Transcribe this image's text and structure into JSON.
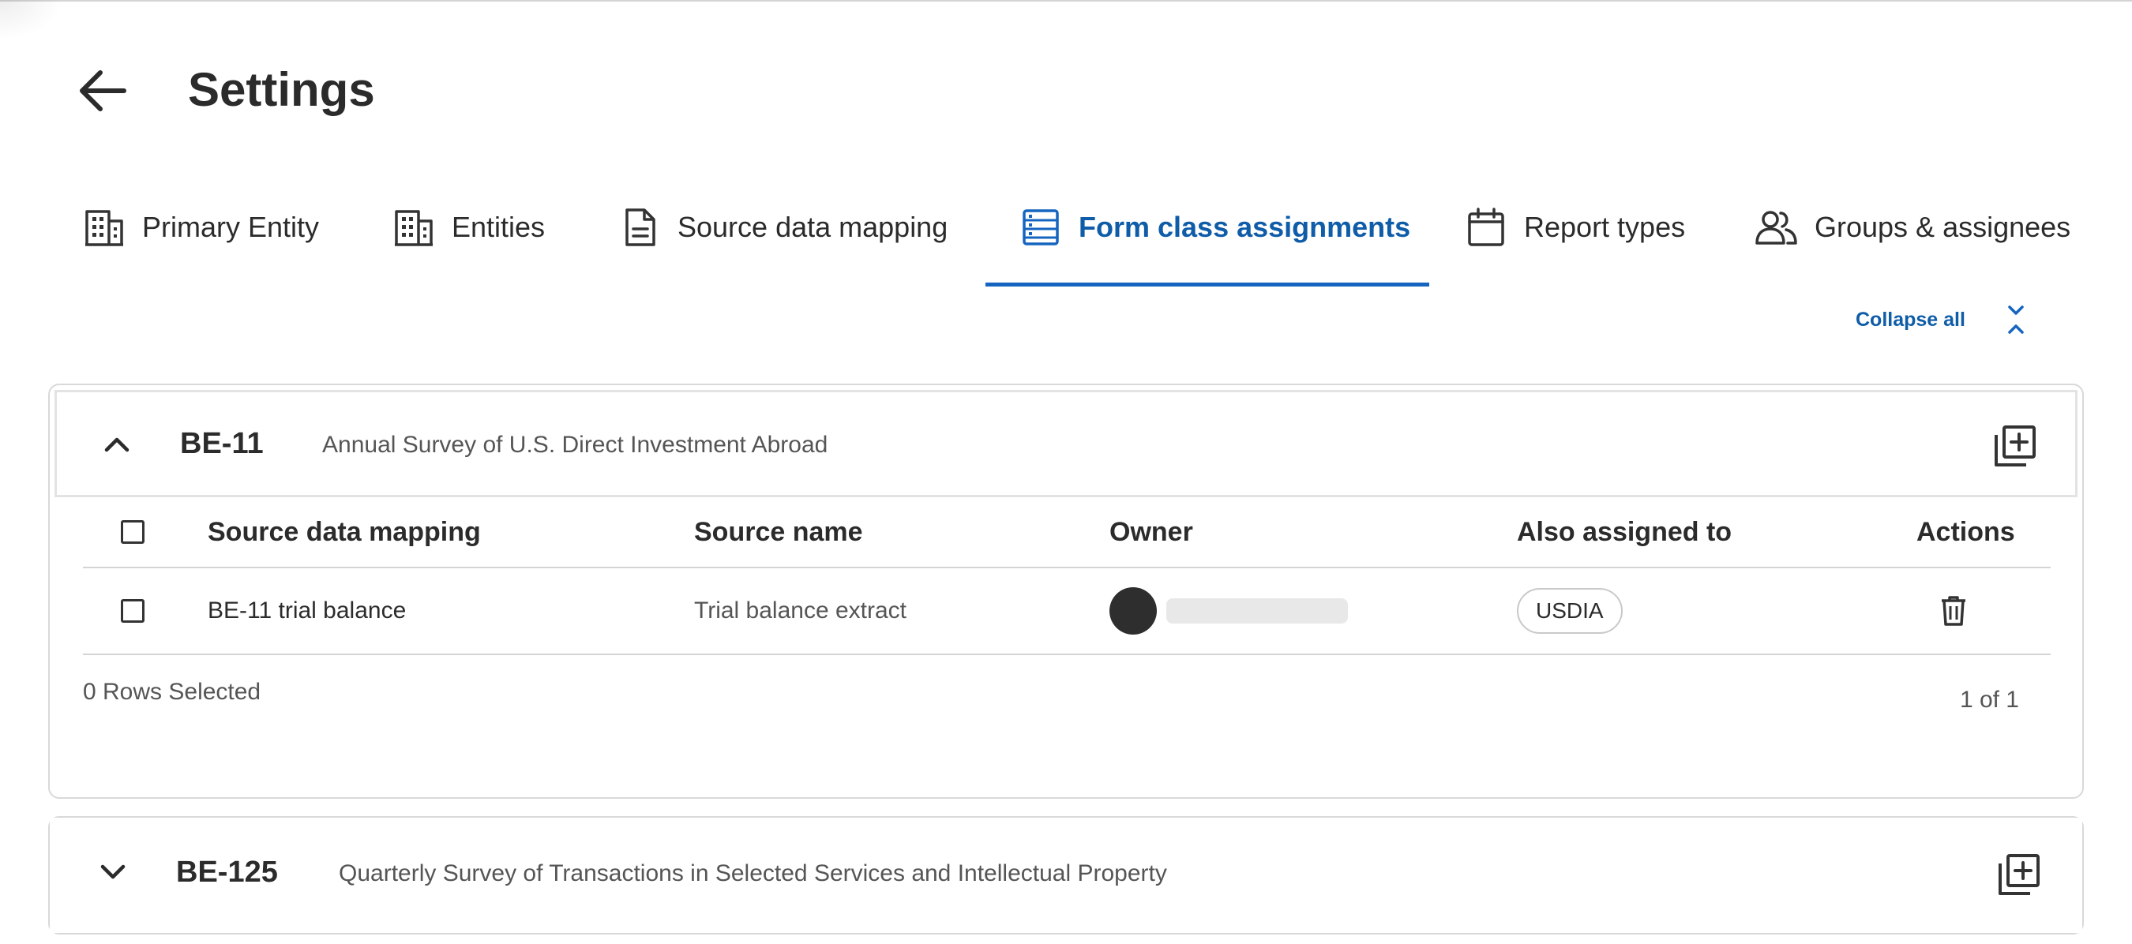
{
  "header": {
    "title": "Settings",
    "back_icon": "arrow-left-icon"
  },
  "tabs": [
    {
      "label": "Primary Entity",
      "icon": "building-icon",
      "active": false
    },
    {
      "label": "Entities",
      "icon": "building-icon",
      "active": false
    },
    {
      "label": "Source data mapping",
      "icon": "document-icon",
      "active": false
    },
    {
      "label": "Form class assignments",
      "icon": "list-table-icon",
      "active": true
    },
    {
      "label": "Report types",
      "icon": "calendar-icon",
      "active": false
    },
    {
      "label": "Groups & assignees",
      "icon": "users-icon",
      "active": false
    }
  ],
  "colors": {
    "accent": "#1565c0",
    "accent_text": "#0f5ca8",
    "text": "#2b2b2b",
    "muted_text": "#555555",
    "border": "#d9d9d9"
  },
  "toolbar": {
    "collapse_all_label": "Collapse all",
    "collapse_icon": "collapse-chevrons-icon"
  },
  "form_classes": [
    {
      "code": "BE-11",
      "description": "Annual Survey of U.S. Direct Investment Abroad",
      "expanded": true,
      "table": {
        "columns": [
          "Source data mapping",
          "Source name",
          "Owner",
          "Also assigned to",
          "Actions"
        ],
        "rows": [
          {
            "source_data_mapping": "BE-11 trial balance",
            "source_name": "Trial balance extract",
            "also_assigned_to": "USDIA",
            "action_icon": "trash-icon",
            "checked": false
          }
        ],
        "rows_selected": "0 Rows Selected",
        "pagination": "1 of 1"
      }
    },
    {
      "code": "BE-125",
      "description": "Quarterly Survey of Transactions in Selected Services and Intellectual Property",
      "expanded": false
    }
  ]
}
